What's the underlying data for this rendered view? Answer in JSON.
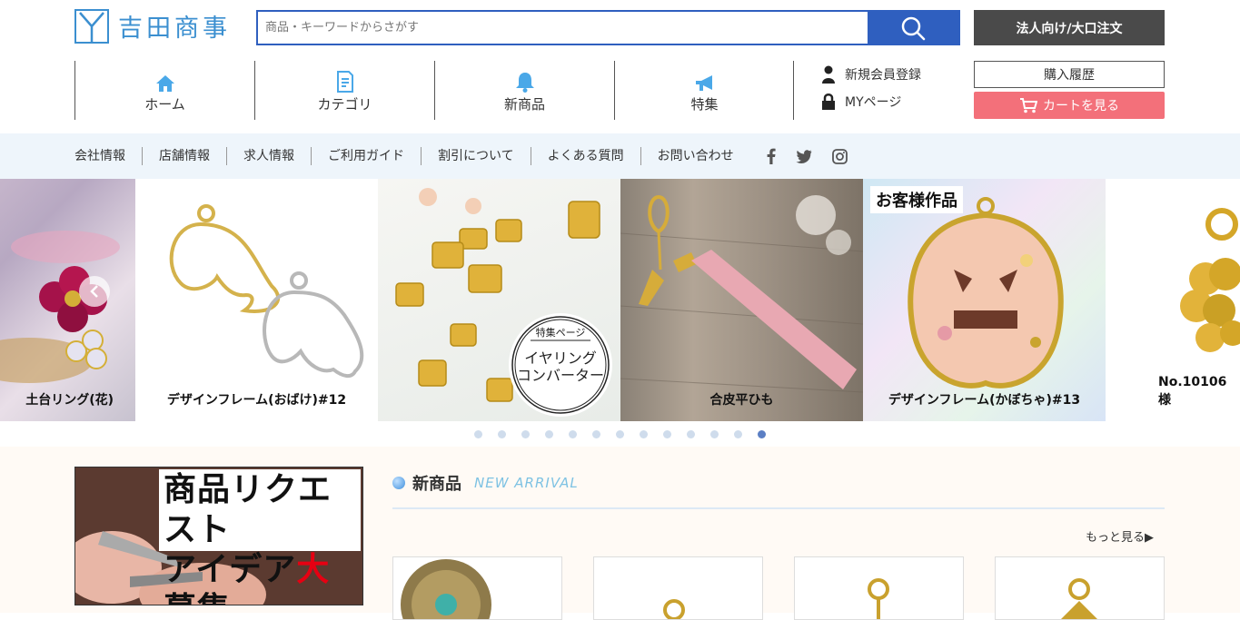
{
  "brand": {
    "name": "吉田商事"
  },
  "search": {
    "placeholder": "商品・キーワードからさがす"
  },
  "header": {
    "corporate_button": "法人向け/大口注文",
    "nav": [
      {
        "label": "ホーム",
        "icon": "home-icon"
      },
      {
        "label": "カテゴリ",
        "icon": "document-icon"
      },
      {
        "label": "新商品",
        "icon": "bell-icon"
      },
      {
        "label": "特集",
        "icon": "megaphone-icon"
      }
    ],
    "account": {
      "register": "新規会員登録",
      "mypage": "MYページ"
    },
    "history_button": "購入履歴",
    "cart_button": "カートを見る"
  },
  "subnav": {
    "links": [
      "会社情報",
      "店舗情報",
      "求人情報",
      "ご利用ガイド",
      "割引について",
      "よくある質問",
      "お問い合わせ"
    ],
    "social": [
      "facebook-icon",
      "twitter-icon",
      "instagram-icon"
    ]
  },
  "slider": {
    "slides": [
      {
        "caption": "土台リング(花)"
      },
      {
        "caption": "デザインフレーム(おばけ)#12"
      },
      {
        "caption": "",
        "badge_title": "特集ページ",
        "badge_text1": "イヤリング",
        "badge_text2": "コンバーター"
      },
      {
        "caption": "合皮平ひも"
      },
      {
        "caption": "デザインフレーム(かぼちゃ)#13",
        "tag": "お客様作品"
      },
      {
        "caption": "No.10106　様"
      }
    ],
    "dot_count": 13,
    "active_dot": 12
  },
  "banner": {
    "line1": "商品リクエスト",
    "line2_a": "アイデア",
    "line2_b": "大",
    "line2_c": "募集"
  },
  "new_arrivals": {
    "title": "新商品",
    "subtitle": "NEW ARRIVAL",
    "more": "もっと見る▶"
  },
  "colors": {
    "accent_blue": "#2f5fbf",
    "cart_pink": "#f3707a",
    "logo_blue": "#3b8fd0",
    "subnav_bg": "#eef5fb"
  }
}
